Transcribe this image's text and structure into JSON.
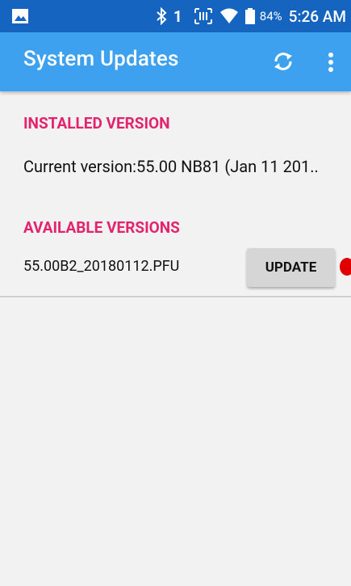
{
  "status_bar": {
    "signal_digit": "1",
    "battery_percent": "84%",
    "time": "5:26 AM",
    "icons": [
      "image-notification-icon",
      "bluetooth-icon",
      "scanner-icon",
      "wifi-icon",
      "battery-icon"
    ]
  },
  "app_bar": {
    "title": "System Updates",
    "actions": [
      "refresh-icon",
      "more-options-icon"
    ],
    "color": "#3ea1ef"
  },
  "installed": {
    "header": "INSTALLED VERSION",
    "current": "Current version:55.00 NB81 (Jan 11 201.."
  },
  "available": {
    "header": "AVAILABLE VERSIONS",
    "items": [
      {
        "filename": "55.00B2_20180112.PFU",
        "button_label": "UPDATE"
      }
    ]
  },
  "accent_color": "#e3246d"
}
